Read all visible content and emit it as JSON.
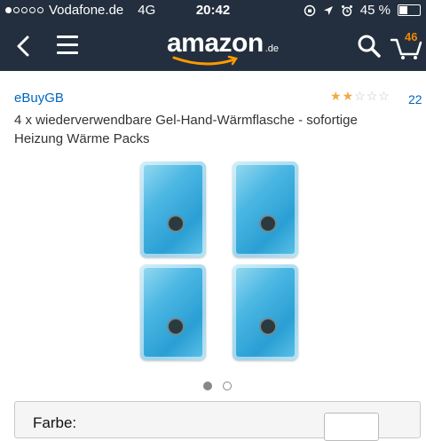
{
  "status": {
    "carrier": "Vodafone.de",
    "network": "4G",
    "time": "20:42",
    "battery": "45 %",
    "signal_full": 1,
    "signal_total": 5,
    "battery_level": 0.45
  },
  "nav": {
    "logo_word": "amazon",
    "logo_tld": ".de",
    "cart_count": "46"
  },
  "product": {
    "seller": "eBuyGB",
    "rating": 2,
    "rating_max": 5,
    "review_count": "22",
    "title": "4 x wiederverwendbare Gel-Hand-Wärmflasche - sofortige Heizung Wärme Packs"
  },
  "gallery": {
    "page_count": 2,
    "active_page": 1
  },
  "options": {
    "label": "Farbe:"
  },
  "colors": {
    "header_bg": "#232f3e",
    "link": "#0066c0",
    "cart_badge": "#f08804",
    "star_on": "#f3a847"
  }
}
